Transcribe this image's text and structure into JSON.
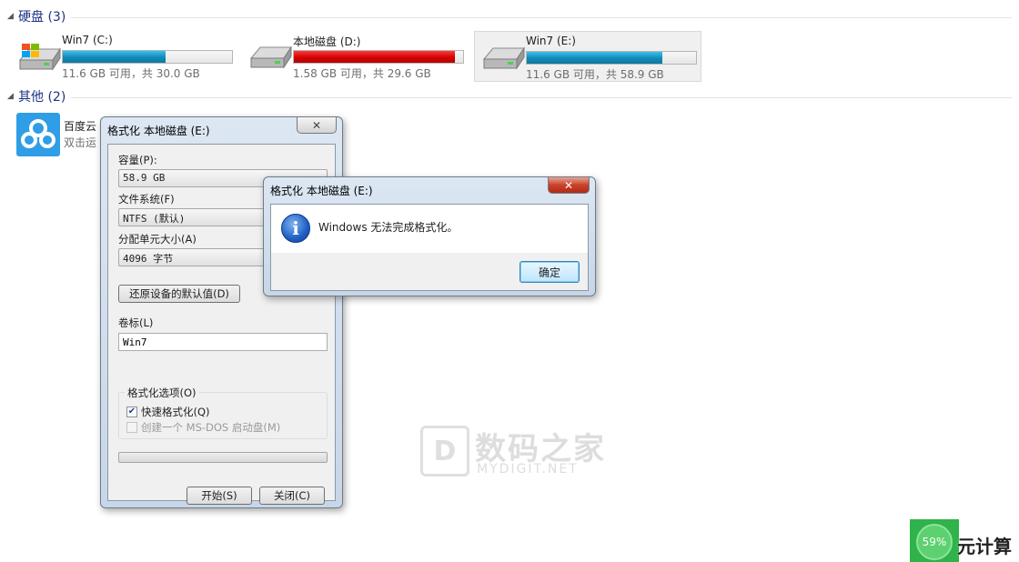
{
  "groups": {
    "hard_disks": {
      "title": "硬盘 (3)"
    },
    "others": {
      "title": "其他 (2)"
    }
  },
  "drives": [
    {
      "name": "Win7 (C:)",
      "free_text": "11.6 GB 可用，共 30.0 GB",
      "used_fraction": 0.61,
      "bar_color": "#1389b6",
      "icon": "windows-drive-icon"
    },
    {
      "name": "本地磁盘 (D:)",
      "free_text": "1.58 GB 可用，共 29.6 GB",
      "used_fraction": 0.95,
      "bar_color": "#d40000",
      "icon": "hard-drive-icon"
    },
    {
      "name": "Win7 (E:)",
      "free_text": "11.6 GB 可用，共 58.9 GB",
      "used_fraction": 0.8,
      "bar_color": "#1389b6",
      "icon": "hard-drive-icon"
    }
  ],
  "other_items": [
    {
      "name": "百度云",
      "subtitle": "双击运",
      "icon": "baidu-cloud-icon"
    }
  ],
  "format_dialog": {
    "title": "格式化 本地磁盘 (E:)",
    "close_glyph": "✕",
    "capacity_label": "容量(P):",
    "capacity_value": "58.9 GB",
    "filesystem_label": "文件系统(F)",
    "filesystem_value": "NTFS (默认)",
    "alloc_label": "分配单元大小(A)",
    "alloc_value": "4096 字节",
    "restore_button": "还原设备的默认值(D)",
    "volume_label": "卷标(L)",
    "volume_value": "Win7",
    "options_title": "格式化选项(O)",
    "quick_format_label": "快速格式化(Q)",
    "quick_format_checked": true,
    "msdos_label": "创建一个 MS-DOS 启动盘(M)",
    "msdos_checked": false,
    "start_button": "开始(S)",
    "close_button": "关闭(C)"
  },
  "message_box": {
    "title": "格式化 本地磁盘 (E:)",
    "close_glyph": "✕",
    "icon": "info-icon",
    "icon_glyph": "i",
    "message": "Windows 无法完成格式化。",
    "ok_button": "确定"
  },
  "watermark": {
    "logo_glyph": "D",
    "text_cn": "数码之家",
    "text_en": "MYDIGIT.NET"
  },
  "corner_widget": {
    "percent": "59%",
    "text": "元计算"
  },
  "colors": {
    "group_header": "#1e3287",
    "bar_blue": "#1389b6",
    "bar_red": "#d40000",
    "widget_green": "#2fb34a"
  }
}
